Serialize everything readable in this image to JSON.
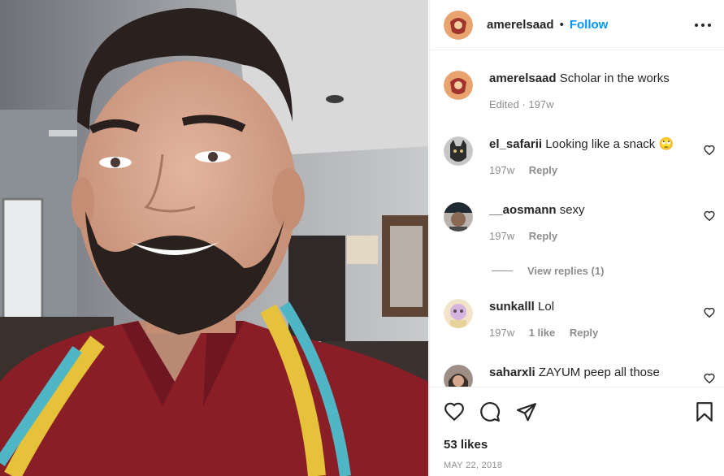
{
  "post": {
    "author": "amerelsaad",
    "follow_label": "Follow",
    "separator": "•",
    "caption": {
      "username": "amerelsaad",
      "text": "Scholar in the works",
      "meta": "Edited · 197w"
    },
    "photo_alt": "photo"
  },
  "comments": [
    {
      "username": "el_safarii",
      "text": "Looking like a snack 🙄",
      "age": "197w",
      "likes": "",
      "reply_label": "Reply"
    },
    {
      "username": "__aosmann",
      "text": "sexy",
      "age": "197w",
      "likes": "",
      "reply_label": "Reply"
    },
    {
      "username": "sunkalll",
      "text": "Lol",
      "age": "197w",
      "likes": "1 like",
      "reply_label": "Reply"
    },
    {
      "username": "saharxli",
      "text": "ZAYUM peep all those",
      "age": "",
      "likes": "",
      "reply_label": ""
    }
  ],
  "view_replies_label": "View replies (1)",
  "footer": {
    "likes": "53 likes",
    "date": "MAY 22, 2018"
  },
  "icons": {
    "more": "more-options-icon",
    "like": "heart-icon",
    "comment": "comment-icon",
    "share": "share-icon",
    "save": "bookmark-icon"
  },
  "colors": {
    "accent": "#0095f6",
    "text": "#262626",
    "muted": "#8e8e8e",
    "border": "#efefef"
  }
}
